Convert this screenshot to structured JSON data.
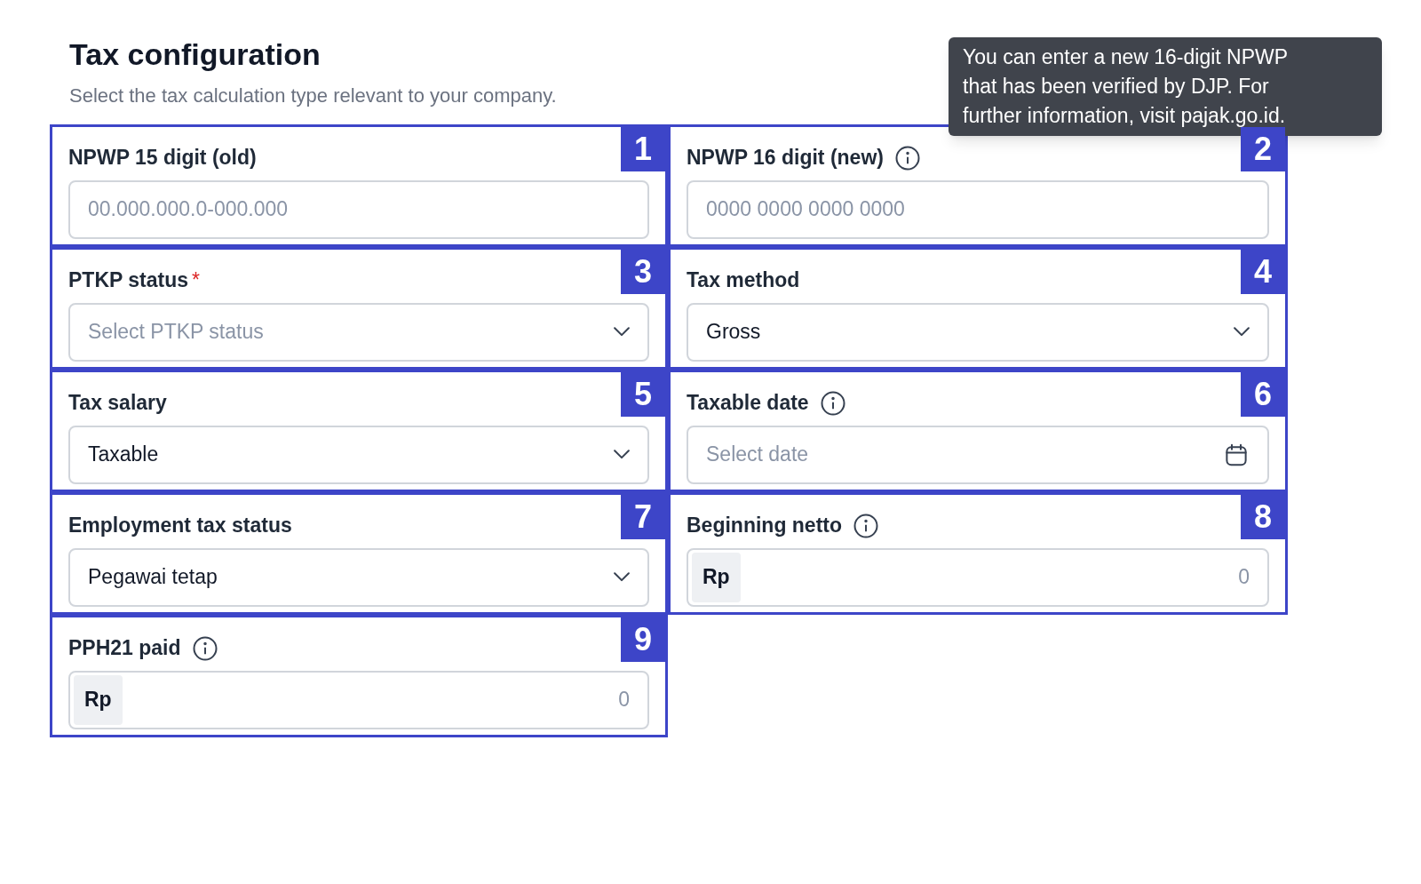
{
  "header": {
    "title": "Tax configuration",
    "subtitle": "Select the tax calculation type relevant to your company."
  },
  "tooltip": {
    "text": "You can enter a new 16-digit NPWP that has been verified by DJP. For further information, visit pajak.go.id."
  },
  "fields": [
    {
      "marker": "1",
      "kind": "text",
      "label": "NPWP 15 digit (old)",
      "info": false,
      "placeholder": "00.000.000.0-000.000"
    },
    {
      "marker": "2",
      "kind": "text",
      "label": "NPWP 16 digit (new)",
      "info": true,
      "placeholder": "0000 0000 0000 0000"
    },
    {
      "marker": "3",
      "kind": "select",
      "label": "PTKP status",
      "required_mark": "*",
      "info": false,
      "placeholder": "Select PTKP status"
    },
    {
      "marker": "4",
      "kind": "select",
      "label": "Tax method",
      "info": false,
      "value": "Gross"
    },
    {
      "marker": "5",
      "kind": "select",
      "label": "Tax salary",
      "info": false,
      "value": "Taxable"
    },
    {
      "marker": "6",
      "kind": "date",
      "label": "Taxable date",
      "info": true,
      "placeholder": "Select date"
    },
    {
      "marker": "7",
      "kind": "select",
      "label": "Employment tax status",
      "info": false,
      "value": "Pegawai tetap"
    },
    {
      "marker": "8",
      "kind": "currency",
      "label": "Beginning netto",
      "info": true,
      "prefix": "Rp",
      "placeholder": "0"
    },
    {
      "marker": "9",
      "kind": "currency",
      "label": "PPH21 paid",
      "info": true,
      "prefix": "Rp",
      "placeholder": "0"
    }
  ]
}
